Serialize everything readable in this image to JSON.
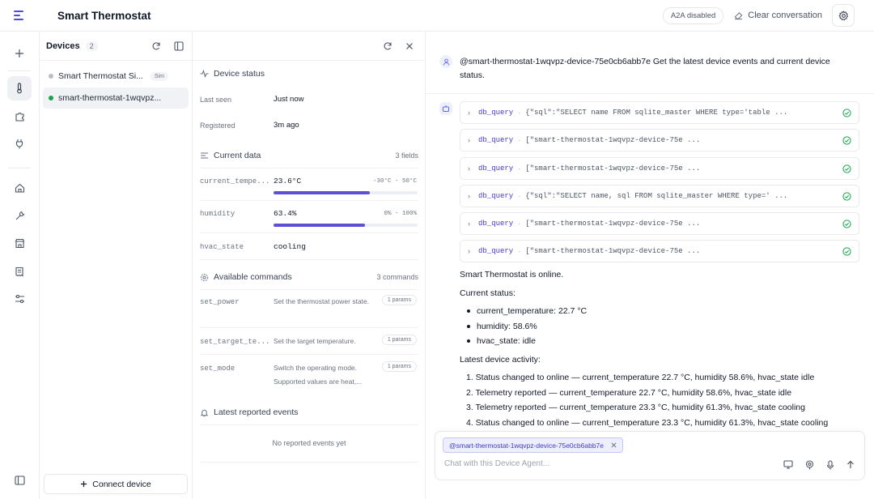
{
  "header": {
    "title": "Smart Thermostat",
    "a2a_label": "A2A disabled",
    "clear_label": "Clear conversation"
  },
  "devices_panel": {
    "title": "Devices",
    "count": "2",
    "items": [
      {
        "name": "Smart Thermostat Si...",
        "badge": "Sim",
        "status_color": "#b9bcc4"
      },
      {
        "name": "smart-thermostat-1wqvpz...",
        "status_color": "#16a34a"
      }
    ],
    "connect_label": "Connect device"
  },
  "device_status": {
    "title": "Device status",
    "last_seen_label": "Last seen",
    "last_seen_value": "Just now",
    "registered_label": "Registered",
    "registered_value": "3m ago"
  },
  "current_data": {
    "title": "Current data",
    "fields_count": "3 fields",
    "rows": [
      {
        "key": "current_tempe...",
        "value": "23.6°C",
        "range": "-30°C - 50°C",
        "fill": 0.67
      },
      {
        "key": "humidity",
        "value": "63.4%",
        "range": "0% - 100%",
        "fill": 0.634
      },
      {
        "key": "hvac_state",
        "value": "cooling"
      }
    ]
  },
  "commands": {
    "title": "Available commands",
    "count": "3 commands",
    "items": [
      {
        "name": "set_power",
        "desc": "Set the thermostat power state.",
        "params": "1 params"
      },
      {
        "name": "set_target_te...",
        "desc": "Set the target temperature.",
        "params": "1 params"
      },
      {
        "name": "set_mode",
        "desc": "Switch the operating mode. Supported values are heat,...",
        "params": "1 params"
      }
    ]
  },
  "events": {
    "title": "Latest reported events",
    "empty": "No reported events yet"
  },
  "chat": {
    "user_message": "@smart-thermostat-1wqvpz-device-75e0cb6abb7e Get the latest device events and current device status.",
    "tool_calls": [
      {
        "name": "db_query",
        "args": "{\"sql\":\"SELECT name FROM sqlite_master WHERE type='table ..."
      },
      {
        "name": "db_query",
        "args": "[\"smart-thermostat-1wqvpz-device-75e ..."
      },
      {
        "name": "db_query",
        "args": "[\"smart-thermostat-1wqvpz-device-75e ..."
      },
      {
        "name": "db_query",
        "args": "{\"sql\":\"SELECT name, sql FROM sqlite_master WHERE type=' ..."
      },
      {
        "name": "db_query",
        "args": "[\"smart-thermostat-1wqvpz-device-75e ..."
      },
      {
        "name": "db_query",
        "args": "[\"smart-thermostat-1wqvpz-device-75e ..."
      }
    ],
    "online_text": "Smart Thermostat is online.",
    "status_heading": "Current status:",
    "status_items": [
      "current_temperature: 22.7 °C",
      "humidity: 58.6%",
      "hvac_state: idle"
    ],
    "activity_heading": "Latest device activity:",
    "activity_items": [
      "1. Status changed to online — current_temperature 22.7 °C, humidity 58.6%, hvac_state idle",
      "2. Telemetry reported — current_temperature 22.7 °C, humidity 58.6%, hvac_state idle",
      "3. Telemetry reported — current_temperature 23.3 °C, humidity 61.3%, hvac_state cooling",
      "4. Status changed to online — current_temperature 23.3 °C, humidity 61.3%, hvac_state cooling"
    ],
    "composer_chip": "@smart-thermostat-1wqvpz-device-75e0cb6abb7e",
    "composer_placeholder": "Chat with this Device Agent..."
  },
  "colors": {
    "accent": "#5b50d6",
    "success": "#16a34a",
    "link": "#4338ca"
  }
}
